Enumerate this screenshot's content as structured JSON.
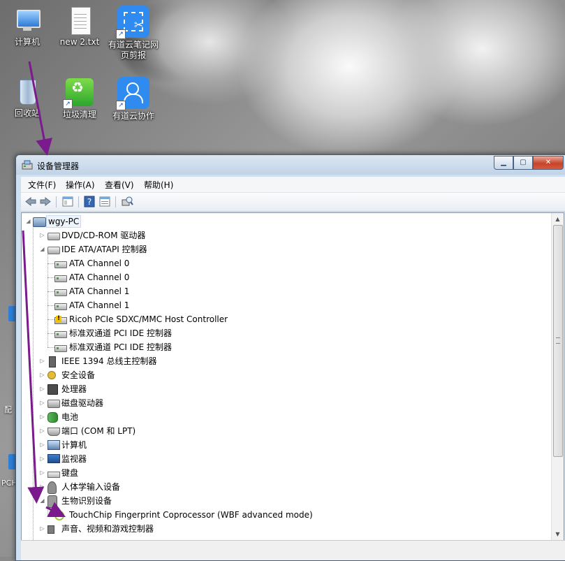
{
  "desktop": {
    "icons": [
      {
        "label": "计算机",
        "icon": "computer-icon"
      },
      {
        "label": "new 2.txt",
        "icon": "text-file-icon"
      },
      {
        "label": "有道云笔记网页剪报",
        "icon": "youdao-clipper-icon"
      },
      {
        "label": "回收站",
        "icon": "recycle-bin-icon"
      },
      {
        "label": "垃圾清理",
        "icon": "cleanup-icon"
      },
      {
        "label": "有道云协作",
        "icon": "youdao-collab-icon"
      }
    ],
    "edge_fragments": [
      "配",
      "PCH"
    ]
  },
  "window": {
    "title": "设备管理器",
    "buttons": {
      "minimize": "▁",
      "maximize": "▢",
      "close": "✕"
    }
  },
  "menu": [
    "文件(F)",
    "操作(A)",
    "查看(V)",
    "帮助(H)"
  ],
  "toolbar": [
    "back-icon",
    "forward-icon",
    "show-hide-tree-icon",
    "help-icon",
    "properties-icon",
    "scan-hardware-icon"
  ],
  "tree": {
    "root": "wgy-PC",
    "items": [
      {
        "label": "DVD/CD-ROM 驱动器",
        "icon": "dvd-drive-icon",
        "expander": "▷"
      },
      {
        "label": "IDE ATA/ATAPI 控制器",
        "icon": "ide-controller-icon",
        "expander": "◢"
      },
      {
        "label": "ATA Channel 0",
        "icon": "ata-channel-icon",
        "child": true
      },
      {
        "label": "ATA Channel 0",
        "icon": "ata-channel-icon",
        "child": true
      },
      {
        "label": "ATA Channel 1",
        "icon": "ata-channel-icon",
        "child": true
      },
      {
        "label": "ATA Channel 1",
        "icon": "ata-channel-icon",
        "child": true
      },
      {
        "label": "Ricoh PCIe SDXC/MMC Host Controller",
        "icon": "warning-device-icon",
        "child": true
      },
      {
        "label": "标准双通道 PCI IDE 控制器",
        "icon": "ata-channel-icon",
        "child": true
      },
      {
        "label": "标准双通道 PCI IDE 控制器",
        "icon": "ata-channel-icon",
        "child": true
      },
      {
        "label": "IEEE 1394 总线主控制器",
        "icon": "ieee1394-icon",
        "expander": "▷"
      },
      {
        "label": "安全设备",
        "icon": "security-key-icon",
        "expander": "▷"
      },
      {
        "label": "处理器",
        "icon": "processor-chip-icon",
        "expander": "▷"
      },
      {
        "label": "磁盘驱动器",
        "icon": "disk-drive-icon",
        "expander": "▷"
      },
      {
        "label": "电池",
        "icon": "battery-icon",
        "expander": "▷"
      },
      {
        "label": "端口 (COM 和 LPT)",
        "icon": "port-icon",
        "expander": "▷"
      },
      {
        "label": "计算机",
        "icon": "computer-icon",
        "expander": "▷"
      },
      {
        "label": "监视器",
        "icon": "monitor-icon",
        "expander": "▷"
      },
      {
        "label": "键盘",
        "icon": "keyboard-icon",
        "expander": "▷"
      },
      {
        "label": "人体学输入设备",
        "icon": "hid-icon",
        "expander": "▷"
      },
      {
        "label": "生物识别设备",
        "icon": "biometric-icon",
        "expander": "◢"
      },
      {
        "label": "TouchChip Fingerprint Coprocessor (WBF advanced mode)",
        "icon": "fingerprint-icon",
        "child": true
      },
      {
        "label": "声音、视频和游戏控制器",
        "icon": "sound-icon",
        "expander": "▷"
      }
    ]
  },
  "scrollbar": {
    "up": "▲",
    "down": "▼"
  },
  "colors": {
    "annotation_arrow": "#7a1a8c",
    "window_frame": "#cfe0f1",
    "selection": "#eef4fb"
  }
}
